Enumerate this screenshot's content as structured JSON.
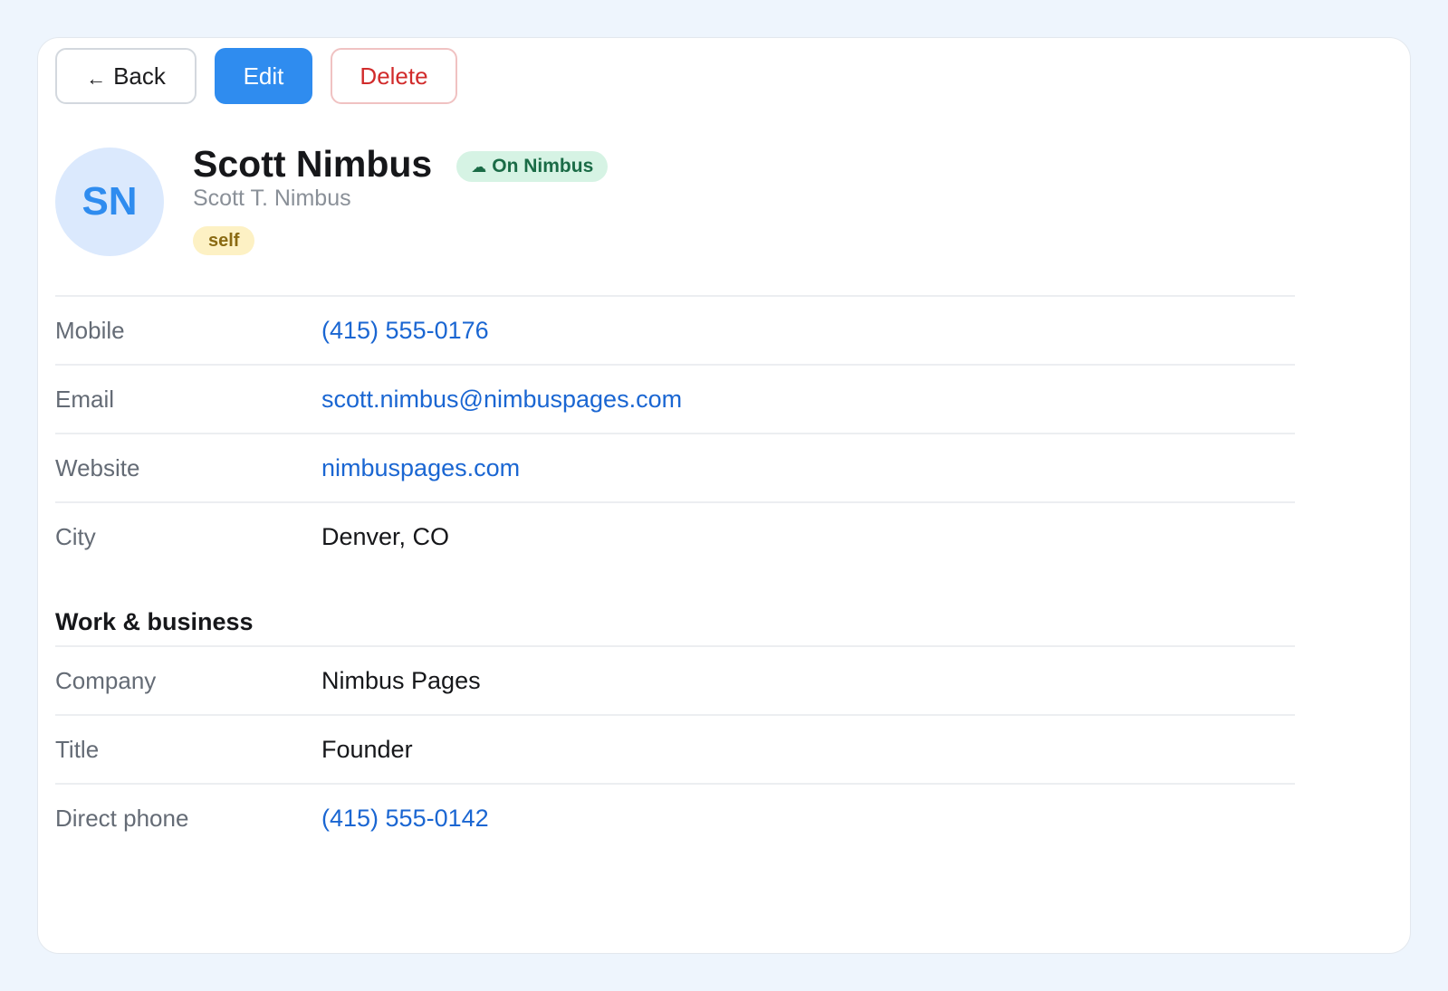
{
  "toolbar": {
    "back_arrow": "←",
    "back_label": "Back",
    "edit_label": "Edit",
    "delete_label": "Delete"
  },
  "contact": {
    "initials": "SN",
    "name": "Scott Nimbus",
    "full_name": "Scott T. Nimbus",
    "status_badge": {
      "icon": "cloud-icon",
      "icon_glyph": "☁",
      "label": "On Nimbus"
    },
    "tag": "self"
  },
  "details": [
    {
      "label": "Mobile",
      "value": "(415) 555-0176",
      "link": true
    },
    {
      "label": "Email",
      "value": "scott.nimbus@nimbuspages.com",
      "link": true
    },
    {
      "label": "Website",
      "value": "nimbuspages.com",
      "link": true
    },
    {
      "label": "City",
      "value": "Denver, CO",
      "link": false
    }
  ],
  "work": {
    "title": "Work & business",
    "rows": [
      {
        "label": "Company",
        "value": "Nimbus Pages",
        "link": false
      },
      {
        "label": "Title",
        "value": "Founder",
        "link": false
      },
      {
        "label": "Direct phone",
        "value": "(415) 555-0142",
        "link": true
      }
    ]
  },
  "colors": {
    "accent": "#2f8cef",
    "link": "#1a66d2",
    "danger": "#d12b2b",
    "badge_green": "#d6f3e4",
    "tag_yellow": "#fdf1c4",
    "page_bg": "#eef5fd"
  }
}
